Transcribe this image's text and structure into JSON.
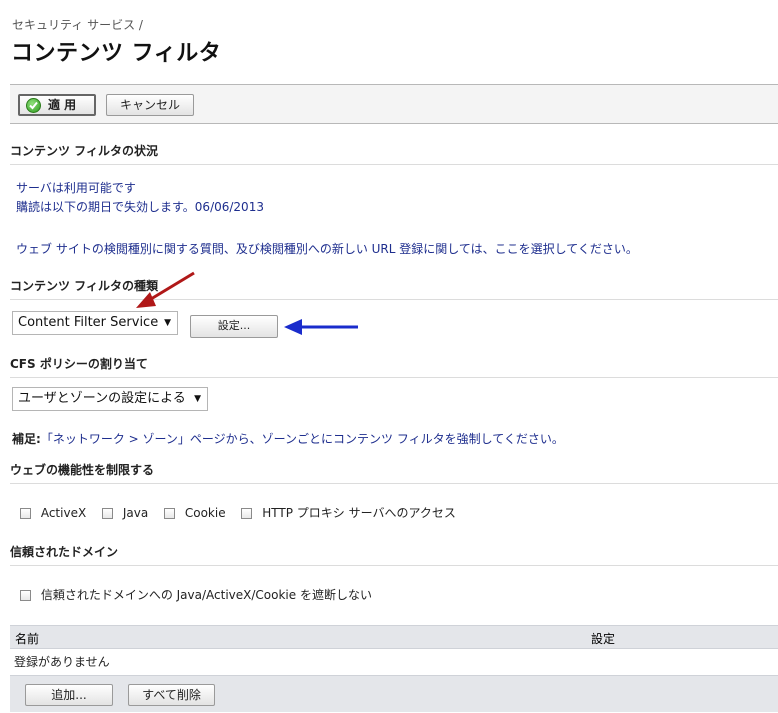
{
  "header": {
    "breadcrumb": "セキュリティ サービス /",
    "title": "コンテンツ フィルタ"
  },
  "toolbar": {
    "apply_label": "適 用",
    "cancel_label": "キャンセル"
  },
  "status": {
    "heading": "コンテンツ フィルタの状況",
    "server_text": "サーバは利用可能です",
    "subscription_text": "購読は以下の期日で失効します。06/06/2013",
    "help_text": "ウェブ サイトの検閲種別に関する質問、及び検閲種別への新しい URL 登録に関しては、ここを選択してください。"
  },
  "filter_type": {
    "heading": "コンテンツ フィルタの種類",
    "selected": "Content Filter Service",
    "configure_label": "設定..."
  },
  "cfs_policy": {
    "heading": "CFS ポリシーの割り当て",
    "selected": "ユーザとゾーンの設定による",
    "note_prefix": "補足:",
    "note_text": "「ネットワーク > ゾーン」ページから、ゾーンごとにコンテンツ フィルタを強制してください。"
  },
  "web_features": {
    "heading": "ウェブの機能性を制限する",
    "options": [
      {
        "label": "ActiveX",
        "checked": false
      },
      {
        "label": "Java",
        "checked": false
      },
      {
        "label": "Cookie",
        "checked": false
      },
      {
        "label": "HTTP プロキシ サーバへのアクセス",
        "checked": false
      }
    ]
  },
  "trusted_domains": {
    "heading": "信頼されたドメイン",
    "checkbox_label": "信頼されたドメインへの Java/ActiveX/Cookie を遮断しない",
    "checkbox_checked": false,
    "columns": [
      "名前",
      "設定"
    ],
    "empty_text": "登録がありません",
    "add_label": "追加...",
    "delete_all_label": "すべて削除"
  },
  "annotations": {
    "red_arrow_color": "#b01818",
    "blue_arrow_color": "#1a2ccc"
  }
}
